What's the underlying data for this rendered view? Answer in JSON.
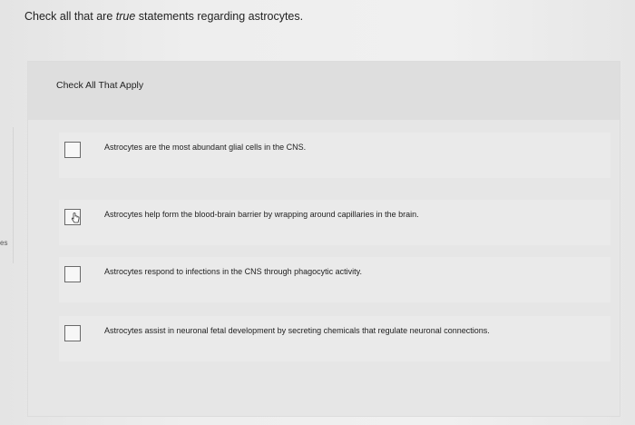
{
  "left_edge_text": "es",
  "question": {
    "prefix": "Check all that are ",
    "emphasis": "true",
    "suffix": " statements regarding astrocytes."
  },
  "panel": {
    "title": "Check All That Apply"
  },
  "options": [
    {
      "label": "Astrocytes are the most abundant glial cells in the CNS.",
      "checked": false
    },
    {
      "label": "Astrocytes help form the blood-brain barrier by wrapping around capillaries in the brain.",
      "checked": false
    },
    {
      "label": "Astrocytes respond to infections in the CNS through phagocytic activity.",
      "checked": false
    },
    {
      "label": "Astrocytes assist in neuronal fetal development by secreting chemicals that regulate neuronal connections.",
      "checked": false
    }
  ],
  "icons": {
    "cursor": "hand-pointer-icon"
  }
}
